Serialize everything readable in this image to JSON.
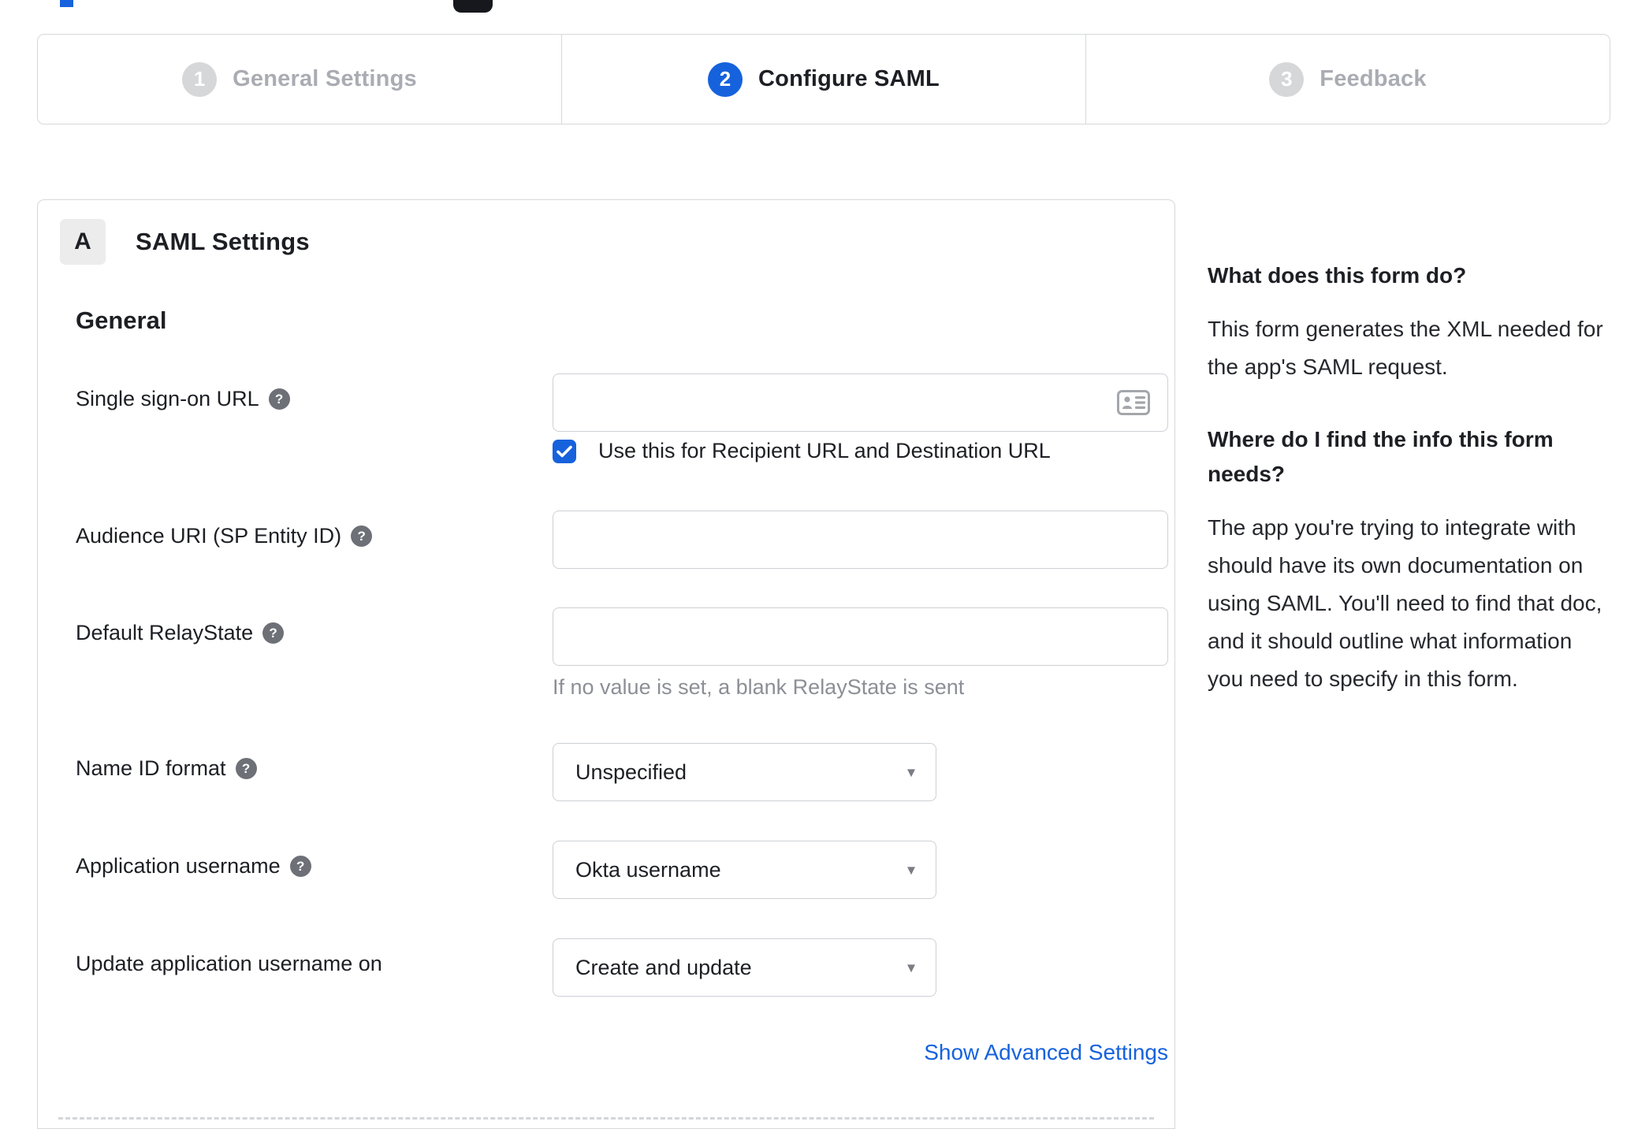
{
  "colors": {
    "accent_blue": "#1662dd",
    "inactive_gray": "#a9acb2",
    "border_gray": "#d6d8db",
    "hint_gray": "#8c8f95"
  },
  "icons": {
    "help": "?",
    "dropdown_arrow": "▾",
    "checkmark": "checkmark-icon",
    "contact_card": "contact-card-icon"
  },
  "stepper": {
    "steps": [
      {
        "number": "1",
        "label": "General Settings",
        "state": "inactive"
      },
      {
        "number": "2",
        "label": "Configure SAML",
        "state": "active"
      },
      {
        "number": "3",
        "label": "Feedback",
        "state": "inactive"
      }
    ]
  },
  "panel": {
    "section_badge": "A",
    "section_title": "SAML Settings",
    "group_heading": "General",
    "fields": [
      {
        "label": "Single sign-on URL",
        "has_help": true,
        "type": "text",
        "value": "",
        "checkbox": {
          "checked": true,
          "label": "Use this for Recipient URL and Destination URL"
        }
      },
      {
        "label": "Audience URI (SP Entity ID)",
        "has_help": true,
        "type": "text",
        "value": ""
      },
      {
        "label": "Default RelayState",
        "has_help": true,
        "type": "text",
        "value": "",
        "hint": "If no value is set, a blank RelayState is sent"
      },
      {
        "label": "Name ID format",
        "has_help": true,
        "type": "select",
        "value": "Unspecified"
      },
      {
        "label": "Application username",
        "has_help": true,
        "type": "select",
        "value": "Okta username"
      },
      {
        "label": "Update application username on",
        "has_help": false,
        "type": "select",
        "value": "Create and update"
      }
    ],
    "advanced_link": "Show Advanced Settings"
  },
  "sidebar": {
    "sections": [
      {
        "heading": "What does this form do?",
        "body": "This form generates the XML needed for the app's SAML request."
      },
      {
        "heading": "Where do I find the info this form needs?",
        "body": "The app you're trying to integrate with should have its own documentation on using SAML. You'll need to find that doc, and it should outline what information you need to specify in this form."
      }
    ]
  }
}
